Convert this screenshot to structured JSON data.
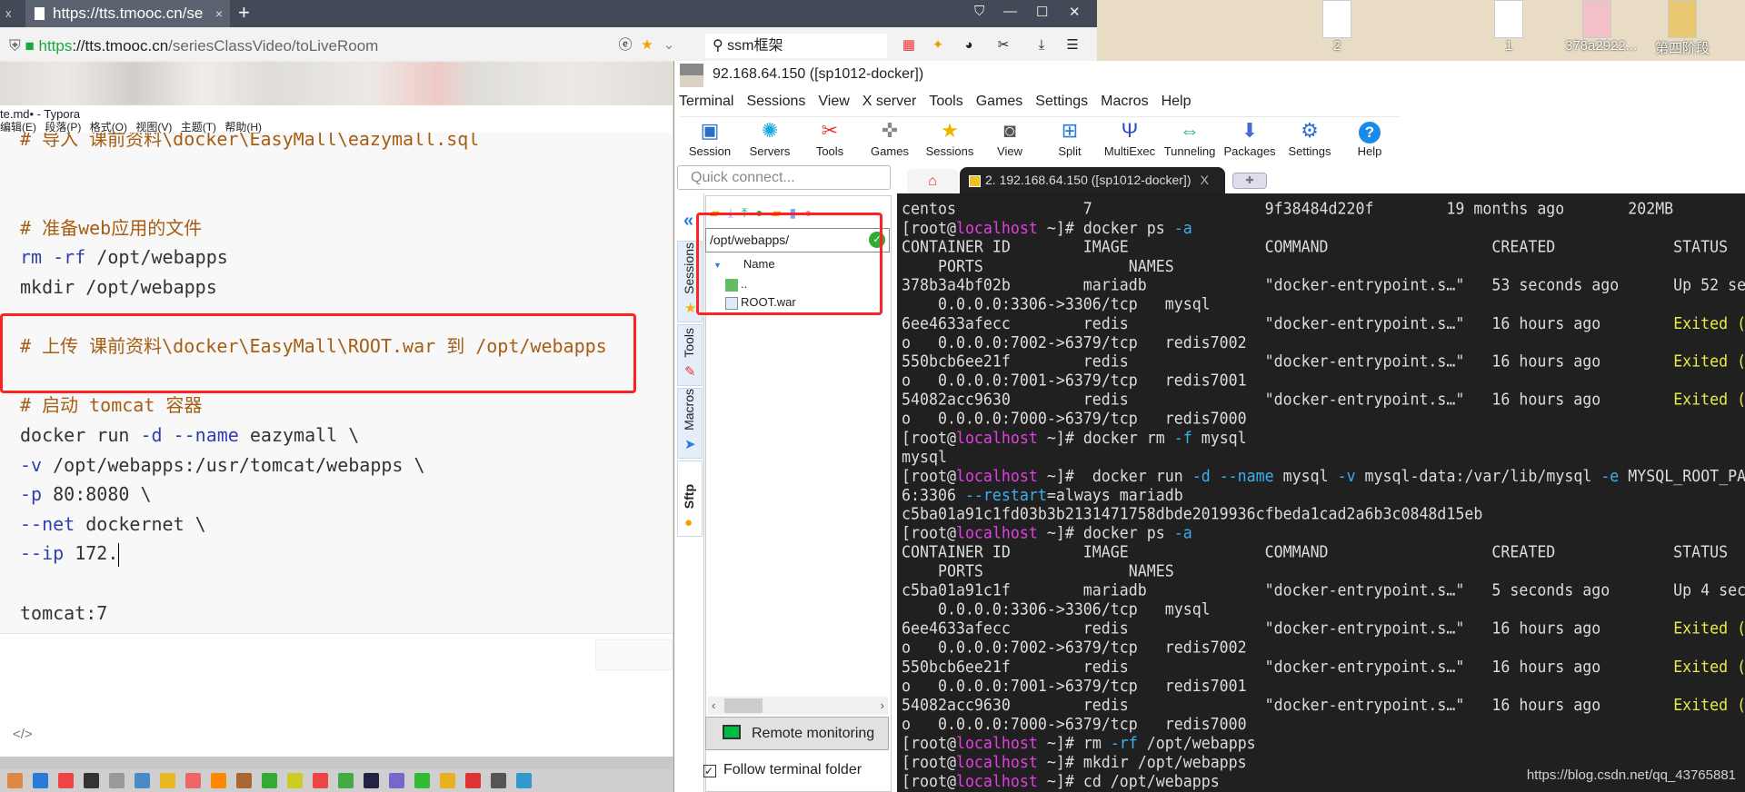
{
  "browser": {
    "tab_title": "https://tts.tmooc.cn/se",
    "url_scheme": "https",
    "url_host": "://tts.tmooc.cn",
    "url_path": "/seriesClassVideo/toLiveRoom",
    "search_value": "ssm框架"
  },
  "desktop": {
    "icons": [
      {
        "label": "2"
      },
      {
        "label": "1"
      },
      {
        "label": "378a2922..."
      },
      {
        "label": "第四阶段"
      }
    ]
  },
  "typora": {
    "title": "te.md• - Typora",
    "menu": [
      "编辑(E)",
      "段落(P)",
      "格式(O)",
      "视图(V)",
      "主题(T)",
      "帮助(H)"
    ],
    "colors": {
      "c": "#a65d14",
      "k": "#2f3fb0",
      "t": "#333333"
    },
    "lines": [
      [
        [
          "# 导入 课前资料\\docker\\EasyMall\\eazymall.sql",
          "c"
        ]
      ],
      [],
      [],
      [
        [
          "# 准备web应用的文件",
          "c"
        ]
      ],
      [
        [
          "rm -rf",
          "k"
        ],
        [
          " /opt/webapps",
          "t"
        ]
      ],
      [
        [
          "mkdir /opt/webapps",
          "t"
        ]
      ],
      [],
      [
        [
          "# 上传 课前资料\\docker\\EasyMall\\ROOT.war 到 /opt/webapps",
          "c"
        ]
      ],
      [],
      [
        [
          "# 启动 tomcat 容器",
          "c"
        ]
      ],
      [
        [
          "docker run ",
          "t"
        ],
        [
          "-d --name",
          "k"
        ],
        [
          " eazymall \\",
          "t"
        ]
      ],
      [
        [
          "-v",
          "k"
        ],
        [
          " /opt/webapps:/usr/tomcat/webapps \\",
          "t"
        ]
      ],
      [
        [
          "-p",
          "k"
        ],
        [
          " 80:8080 \\",
          "t"
        ]
      ],
      [
        [
          "--net",
          "k"
        ],
        [
          " dockernet \\",
          "t"
        ]
      ],
      [
        [
          "--ip",
          "k"
        ],
        [
          " 172.",
          "t"
        ]
      ],
      [],
      [
        [
          "tomcat:7",
          "t"
        ]
      ]
    ]
  },
  "moba": {
    "title": "92.168.64.150 ([sp1012-docker])",
    "menu": [
      "Terminal",
      "Sessions",
      "View",
      "X server",
      "Tools",
      "Games",
      "Settings",
      "Macros",
      "Help"
    ],
    "toolbar": [
      {
        "label": "Session",
        "icon": "monitor-icon"
      },
      {
        "label": "Servers",
        "icon": "servers-icon"
      },
      {
        "label": "Tools",
        "icon": "tools-icon"
      },
      {
        "label": "Games",
        "icon": "gamepad-icon"
      },
      {
        "label": "Sessions",
        "icon": "star-icon"
      },
      {
        "label": "View",
        "icon": "view-icon"
      },
      {
        "label": "Split",
        "icon": "split-icon"
      },
      {
        "label": "MultiExec",
        "icon": "fork-icon"
      },
      {
        "label": "Tunneling",
        "icon": "tunnel-icon"
      },
      {
        "label": "Packages",
        "icon": "package-icon"
      },
      {
        "label": "Settings",
        "icon": "gears-icon"
      },
      {
        "label": "Help",
        "icon": "help-icon"
      }
    ],
    "quick_connect_placeholder": "Quick connect...",
    "session_tab": "2. 192.168.64.150 ([sp1012-docker])",
    "side_tabs": [
      "Sessions",
      "Tools",
      "Macros",
      "Sftp"
    ],
    "sftp": {
      "path": "/opt/webapps/",
      "column": "Name",
      "files": [
        {
          "name": ".."
        },
        {
          "name": "ROOT.war"
        }
      ],
      "remote_monitoring": "Remote monitoring",
      "follow_terminal": "Follow terminal folder",
      "follow_checked": true
    },
    "terminal": {
      "colors": {
        "d": "#dcdcdc",
        "m": "#e040e0",
        "c": "#3ab0f0",
        "y": "#e8e84a"
      },
      "lines": [
        [
          [
            "centos              7                   9f38484d220f        19 months ago       202MB",
            "d"
          ]
        ],
        [
          [
            "[root@",
            "d"
          ],
          [
            "localhost",
            "m"
          ],
          [
            " ~]# docker ps ",
            "d"
          ],
          [
            "-a",
            "c"
          ]
        ],
        [
          [
            "CONTAINER ID        IMAGE               COMMAND                  CREATED             STATUS",
            "d"
          ]
        ],
        [
          [
            "    PORTS                NAMES",
            "d"
          ]
        ],
        [
          [
            "378b3a4bf02b        mariadb             \"docker-entrypoint.s…\"   53 seconds ago      Up 52 se",
            "d"
          ]
        ],
        [
          [
            "    0.0.0.0:3306->3306/tcp   mysql",
            "d"
          ]
        ],
        [
          [
            "6ee4633afecc        redis               \"docker-entrypoint.s…\"   16 hours ago        ",
            "d"
          ],
          [
            "Exited (",
            "y"
          ]
        ],
        [
          [
            "o   0.0.0.0:7002->6379/tcp   redis7002",
            "d"
          ]
        ],
        [
          [
            "550bcb6ee21f        redis               \"docker-entrypoint.s…\"   16 hours ago        ",
            "d"
          ],
          [
            "Exited (",
            "y"
          ]
        ],
        [
          [
            "o   0.0.0.0:7001->6379/tcp   redis7001",
            "d"
          ]
        ],
        [
          [
            "54082acc9630        redis               \"docker-entrypoint.s…\"   16 hours ago        ",
            "d"
          ],
          [
            "Exited (",
            "y"
          ]
        ],
        [
          [
            "o   0.0.0.0:7000->6379/tcp   redis7000",
            "d"
          ]
        ],
        [
          [
            "[root@",
            "d"
          ],
          [
            "localhost",
            "m"
          ],
          [
            " ~]# docker rm ",
            "d"
          ],
          [
            "-f",
            "c"
          ],
          [
            " mysql",
            "d"
          ]
        ],
        [
          [
            "mysql",
            "d"
          ]
        ],
        [
          [
            "[root@",
            "d"
          ],
          [
            "localhost",
            "m"
          ],
          [
            " ~]#  docker run ",
            "d"
          ],
          [
            "-d --name",
            "c"
          ],
          [
            " mysql ",
            "d"
          ],
          [
            "-v",
            "c"
          ],
          [
            " mysql-data:/var/lib/mysql ",
            "d"
          ],
          [
            "-e",
            "c"
          ],
          [
            " MYSQL_ROOT_PA",
            "d"
          ]
        ],
        [
          [
            "6:3306 ",
            "d"
          ],
          [
            "--restart",
            "c"
          ],
          [
            "=always mariadb",
            "d"
          ]
        ],
        [
          [
            "c5ba01a91c1fd03b3b2131471758dbde2019936cfbeda1cad2a6b3c0848d15eb",
            "d"
          ]
        ],
        [
          [
            "[root@",
            "d"
          ],
          [
            "localhost",
            "m"
          ],
          [
            " ~]# docker ps ",
            "d"
          ],
          [
            "-a",
            "c"
          ]
        ],
        [
          [
            "CONTAINER ID        IMAGE               COMMAND                  CREATED             STATUS",
            "d"
          ]
        ],
        [
          [
            "    PORTS                NAMES",
            "d"
          ]
        ],
        [
          [
            "c5ba01a91c1f        mariadb             \"docker-entrypoint.s…\"   5 seconds ago       Up 4 sec",
            "d"
          ]
        ],
        [
          [
            "    0.0.0.0:3306->3306/tcp   mysql",
            "d"
          ]
        ],
        [
          [
            "6ee4633afecc        redis               \"docker-entrypoint.s…\"   16 hours ago        ",
            "d"
          ],
          [
            "Exited (",
            "y"
          ]
        ],
        [
          [
            "o   0.0.0.0:7002->6379/tcp   redis7002",
            "d"
          ]
        ],
        [
          [
            "550bcb6ee21f        redis               \"docker-entrypoint.s…\"   16 hours ago        ",
            "d"
          ],
          [
            "Exited (",
            "y"
          ]
        ],
        [
          [
            "o   0.0.0.0:7001->6379/tcp   redis7001",
            "d"
          ]
        ],
        [
          [
            "54082acc9630        redis               \"docker-entrypoint.s…\"   16 hours ago        ",
            "d"
          ],
          [
            "Exited (",
            "y"
          ]
        ],
        [
          [
            "o   0.0.0.0:7000->6379/tcp   redis7000",
            "d"
          ]
        ],
        [
          [
            "[root@",
            "d"
          ],
          [
            "localhost",
            "m"
          ],
          [
            " ~]# rm ",
            "d"
          ],
          [
            "-rf",
            "c"
          ],
          [
            " /opt/webapps",
            "d"
          ]
        ],
        [
          [
            "[root@",
            "d"
          ],
          [
            "localhost",
            "m"
          ],
          [
            " ~]# mkdir /opt/webapps",
            "d"
          ]
        ],
        [
          [
            "[root@",
            "d"
          ],
          [
            "localhost",
            "m"
          ],
          [
            " ~]# cd /opt/webapps",
            "d"
          ]
        ],
        [
          [
            "[root@",
            "d"
          ],
          [
            "localhost",
            "m"
          ],
          [
            " webapps]# ",
            "d"
          ]
        ]
      ]
    }
  },
  "watermark": "https://blog.csdn.net/qq_43765881",
  "taskbar_icons": [
    "#d84",
    "#2a7ad8",
    "#e44",
    "#333",
    "#999",
    "#4a8ac8",
    "#e8b820",
    "#e66",
    "#f80",
    "#a63",
    "#3a3",
    "#cc2",
    "#e44",
    "#4a4",
    "#224",
    "#76c",
    "#3b3",
    "#e9b020",
    "#d33",
    "#555",
    "#39c"
  ]
}
